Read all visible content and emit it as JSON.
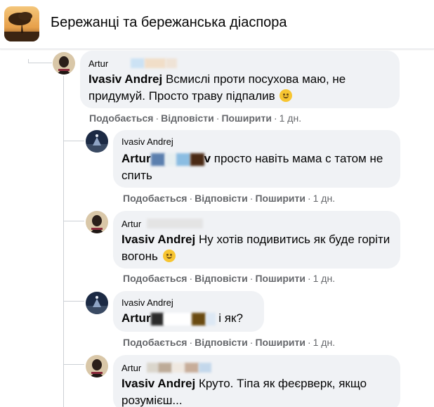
{
  "header": {
    "group_title": "Бережанці та бережанська діаспора",
    "group_avatar_icon": "group-photo-icon"
  },
  "actions": {
    "like": "Подобається",
    "reply": "Відповісти",
    "share": "Поширити",
    "separator": "·"
  },
  "comments": [
    {
      "author": "Artur",
      "mention": "Ivasiv Andrej",
      "text": "Всмислі проти посухова маю, не придумуй. Просто траву підпалив",
      "emoji": "smirk-emoji",
      "time": "1 дн."
    },
    {
      "author": "Ivasiv Andrej",
      "mention_prefix": "Artur",
      "mention_suffix": "v",
      "text": " просто навіть мама с татом не спить",
      "time": "1 дн."
    },
    {
      "author": "Artur",
      "mention": "Ivasiv Andrej",
      "text": "Ну хотів подивитись як буде горіти вогонь",
      "emoji": "smile-emoji",
      "time": "1 дн."
    },
    {
      "author": "Ivasiv Andrej",
      "mention_prefix": "Artur",
      "text": "і як?",
      "time": "1 дн."
    },
    {
      "author": "Artur",
      "mention": "Ivasiv Andrej",
      "text": "Круто. Тіпа як феєрверк, якщо розумієш...",
      "time": ""
    }
  ]
}
